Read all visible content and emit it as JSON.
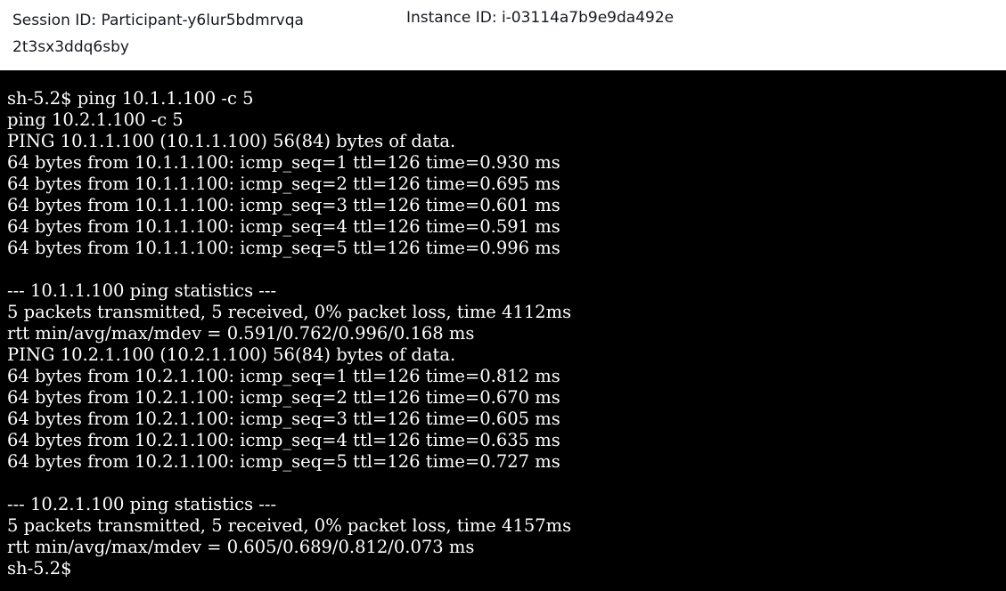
{
  "header": {
    "session_id": "Session ID: Participant-y6lur5bdmrvqa2t3sx3ddq6sby",
    "instance_id": "Instance ID: i-03114a7b9e9da492e"
  },
  "terminal": {
    "lines": [
      "sh-5.2$ ping 10.1.1.100 -c 5",
      "ping 10.2.1.100 -c 5",
      "PING 10.1.1.100 (10.1.1.100) 56(84) bytes of data.",
      "64 bytes from 10.1.1.100: icmp_seq=1 ttl=126 time=0.930 ms",
      "64 bytes from 10.1.1.100: icmp_seq=2 ttl=126 time=0.695 ms",
      "64 bytes from 10.1.1.100: icmp_seq=3 ttl=126 time=0.601 ms",
      "64 bytes from 10.1.1.100: icmp_seq=4 ttl=126 time=0.591 ms",
      "64 bytes from 10.1.1.100: icmp_seq=5 ttl=126 time=0.996 ms",
      "",
      "--- 10.1.1.100 ping statistics ---",
      "5 packets transmitted, 5 received, 0% packet loss, time 4112ms",
      "rtt min/avg/max/mdev = 0.591/0.762/0.996/0.168 ms",
      "PING 10.2.1.100 (10.2.1.100) 56(84) bytes of data.",
      "64 bytes from 10.2.1.100: icmp_seq=1 ttl=126 time=0.812 ms",
      "64 bytes from 10.2.1.100: icmp_seq=2 ttl=126 time=0.670 ms",
      "64 bytes from 10.2.1.100: icmp_seq=3 ttl=126 time=0.605 ms",
      "64 bytes from 10.2.1.100: icmp_seq=4 ttl=126 time=0.635 ms",
      "64 bytes from 10.2.1.100: icmp_seq=5 ttl=126 time=0.727 ms",
      "",
      "--- 10.2.1.100 ping statistics ---",
      "5 packets transmitted, 5 received, 0% packet loss, time 4157ms",
      "rtt min/avg/max/mdev = 0.605/0.689/0.812/0.073 ms",
      "sh-5.2$"
    ]
  },
  "colors": {
    "header_background": "#ffffff",
    "header_text": "#16191f",
    "terminal_background": "#000000",
    "terminal_text": "#ffffff"
  }
}
